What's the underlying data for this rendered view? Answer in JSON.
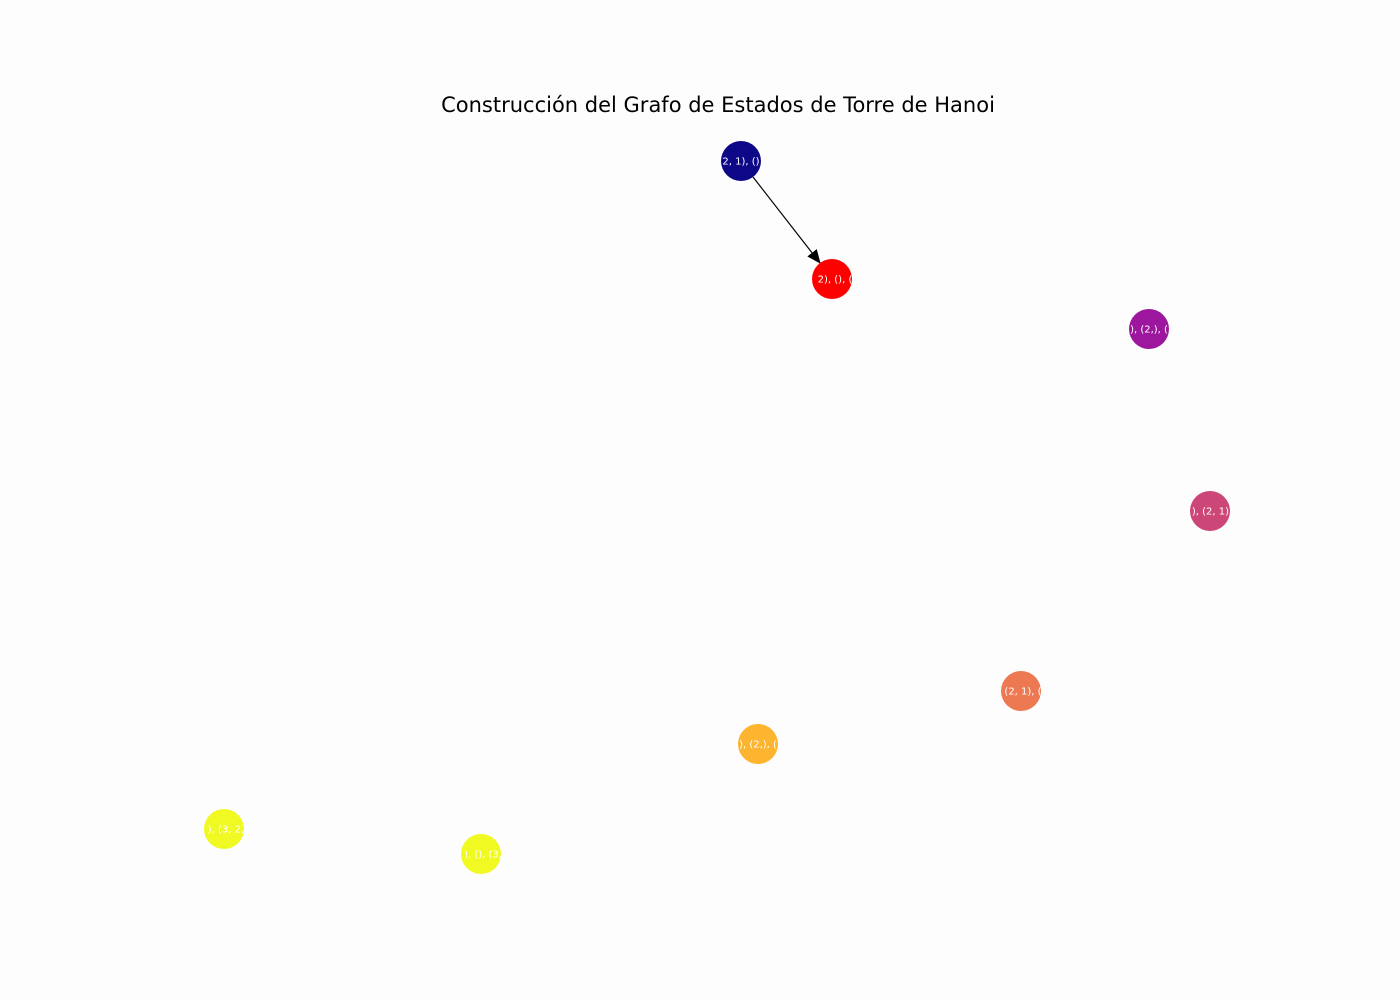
{
  "title": "Construcción del Grafo de Estados de Torre de Hanoi",
  "nodes": [
    {
      "id": "n1",
      "label": "2, 1), ()",
      "color": "#0d0887"
    },
    {
      "id": "n2",
      "label": "2), (), (",
      "color": "#ff0000"
    },
    {
      "id": "n3",
      "label": "), (2,), (",
      "color": "#9c179e"
    },
    {
      "id": "n4",
      "label": "), (2, 1),",
      "color": "#cc4778"
    },
    {
      "id": "n5",
      "label": "(2, 1), (",
      "color": "#ed7953"
    },
    {
      "id": "n6",
      "label": "), (2,), (",
      "color": "#fdb42f"
    },
    {
      "id": "n7",
      "label": "), (3, 2,",
      "color": "#f0f921"
    },
    {
      "id": "n8",
      "label": "), (), (3,",
      "color": "#f0f921"
    }
  ],
  "edges": [
    {
      "from": "n1",
      "to": "n2"
    }
  ]
}
